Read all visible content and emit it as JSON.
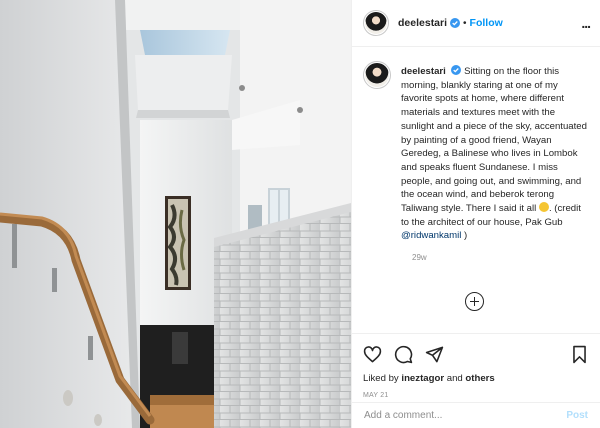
{
  "post": {
    "username": "deelestari",
    "dot": "•",
    "follow_label": "Follow",
    "more_label": "...",
    "caption": {
      "username": "deelestari",
      "text_1": "Sitting on the floor this morning, blankly staring at one of my favorite spots at home, where different materials and textures meet with the sunlight and a piece of the sky, accentuated by painting of a good friend, Wayan Geredeg, a Balinese who lives in Lombok and speaks fluent Sundanese. I miss people, and going out, and swimming, and the ocean wind, and beberok terong Taliwang style. There I said it all ",
      "text_2": ". (credit to the architect of our house, Pak Gub ",
      "mention": "@ridwankamil",
      "text_3": " )"
    },
    "time_ago": "29w",
    "likes": {
      "prefix": "Liked by ",
      "user": "ineztagor",
      "middle": " and ",
      "others": "others"
    },
    "date": "MAY 21",
    "comment": {
      "placeholder": "Add a comment...",
      "post_label": "Post"
    }
  },
  "icons": {
    "verified": "verified-badge-icon",
    "more": "more-options-icon",
    "add_reply": "plus-circle-icon",
    "like": "heart-icon",
    "comment": "comment-icon",
    "share": "paper-plane-icon",
    "save": "bookmark-icon",
    "emoji": "grinning-sweat-emoji"
  },
  "colors": {
    "link": "#0095f6",
    "mention": "#00376b",
    "muted": "#8e8e8e",
    "post_disabled": "#b2dffc",
    "verified": "#3897f0"
  }
}
